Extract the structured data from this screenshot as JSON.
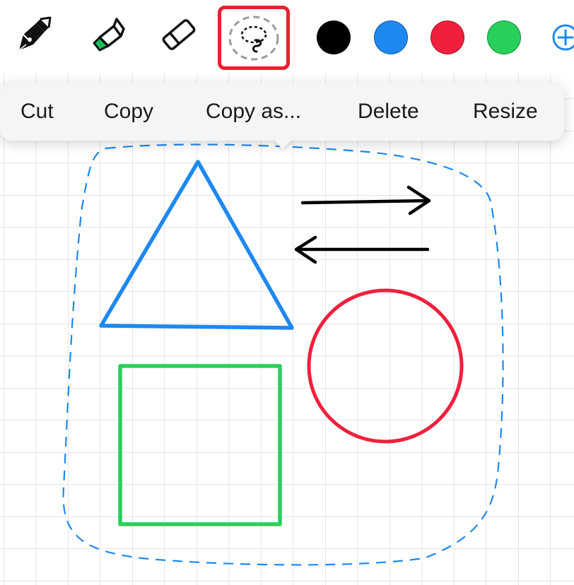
{
  "toolbar": {
    "tools": [
      {
        "name": "pen",
        "icon": "fountain-pen-icon",
        "selected": false
      },
      {
        "name": "highlighter",
        "icon": "highlighter-icon",
        "selected": false
      },
      {
        "name": "eraser",
        "icon": "eraser-icon",
        "selected": false
      },
      {
        "name": "lasso",
        "icon": "lasso-icon",
        "selected": true
      }
    ],
    "colors": [
      "#000000",
      "#1e88f0",
      "#f0203c",
      "#27d05a"
    ],
    "selected_tool_outline": "#e8202e",
    "add_icon": "add-color-icon",
    "add_color": "#1e88f0"
  },
  "context_menu": {
    "items": [
      {
        "label": "Cut"
      },
      {
        "label": "Copy"
      },
      {
        "label": "Copy as..."
      },
      {
        "label": "Delete"
      },
      {
        "label": "Resize"
      }
    ]
  },
  "canvas": {
    "background": "grid",
    "grid_color": "#d4d4d4",
    "shapes": [
      {
        "name": "triangle",
        "color": "#1e88f0"
      },
      {
        "name": "arrow-right",
        "color": "#000000"
      },
      {
        "name": "arrow-left",
        "color": "#000000"
      },
      {
        "name": "circle",
        "color": "#f0203c"
      },
      {
        "name": "square",
        "color": "#27d05a"
      }
    ],
    "selection_outline_color": "#1e88f0"
  }
}
